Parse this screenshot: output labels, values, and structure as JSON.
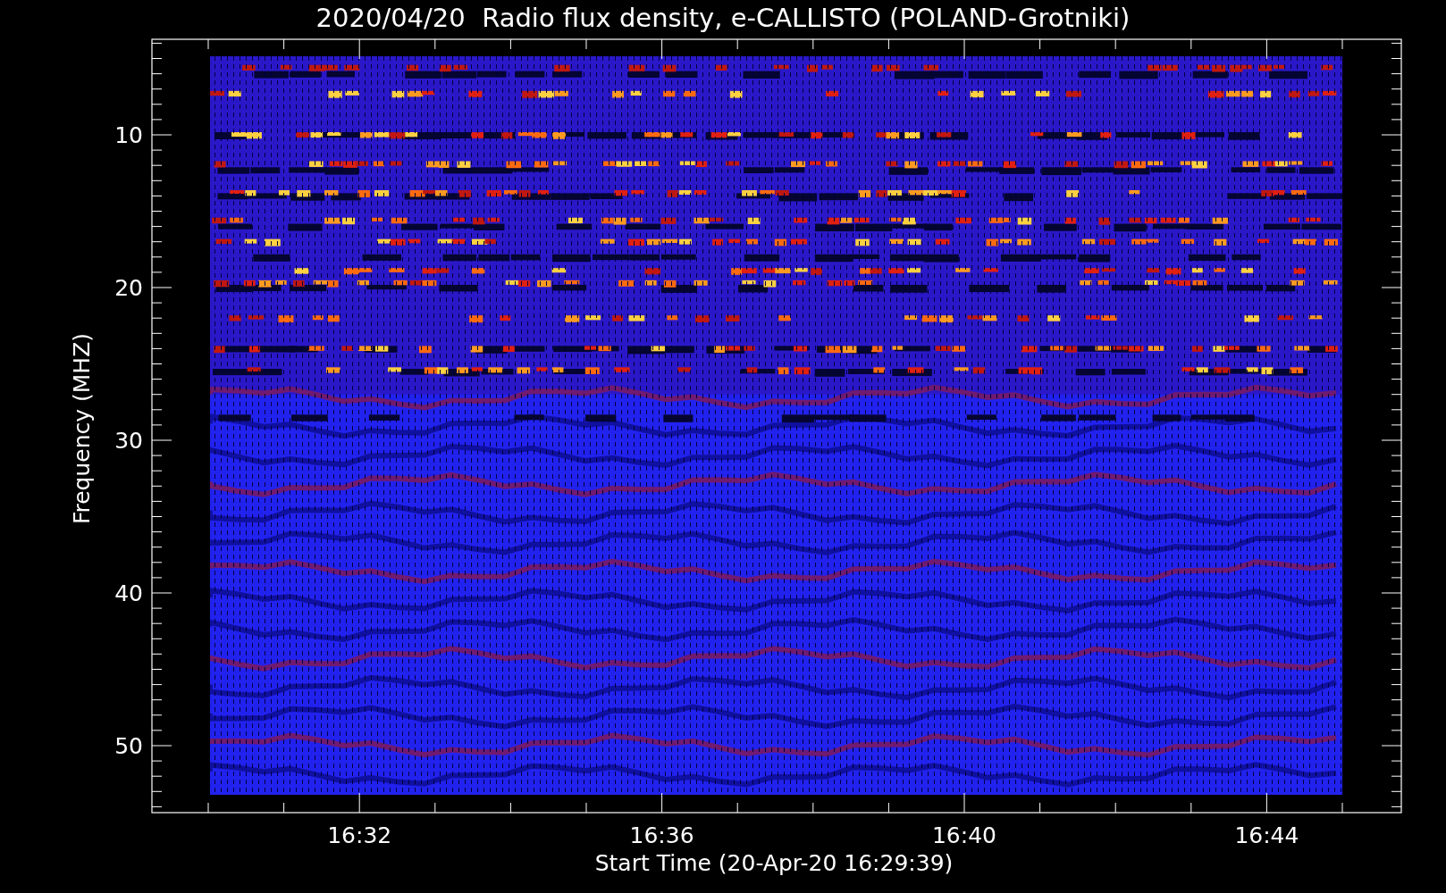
{
  "title": "2020/04/20  Radio flux density, e-CALLISTO (POLAND-Grotniki)",
  "plot": {
    "ylabel": "Frequency (MHZ)",
    "xlabel": "Start Time (20-Apr-20 16:29:39)",
    "yticks": [
      "10",
      "20",
      "30",
      "40",
      "50"
    ],
    "xticks": [
      "16:32",
      "16:36",
      "16:40",
      "16:44"
    ]
  }
}
